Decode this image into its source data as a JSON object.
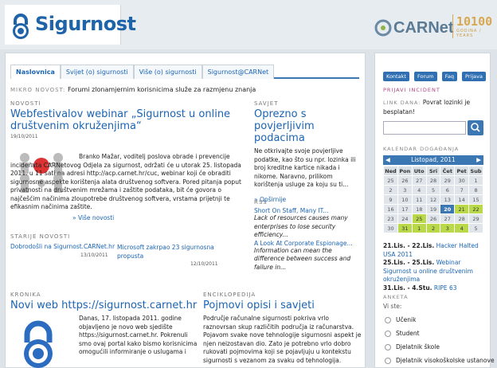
{
  "site": {
    "logo_text": "Sigurnost",
    "carnet_text": "CARNet",
    "tenk_num": "10100",
    "tenk_sub": "GODINA / YEARS"
  },
  "tabs": [
    {
      "label": "Naslovnica"
    },
    {
      "label": "Svijet (o) sigurnosti"
    },
    {
      "label": "Više (o) sigurnosti"
    },
    {
      "label": "Sigurnost@CARNet"
    }
  ],
  "mikro": {
    "label": "MIKRO NOVOST:",
    "text": "Forumi zlonamjernim korisnicima služe za razmjenu znanja"
  },
  "novosti": {
    "label": "NOVOSTI",
    "title": "Webfestivalov webinar „Sigurnost u online društvenim okruženjima“",
    "date": "19/10/2011",
    "body": "Branko Mažar, voditelj poslova obrade i prevencije incidenata CARNetovog Odjela za sigurnost, održati će u utorak 25. listopada 2011. u 11 sati na adresi http://acp.carnet.hr/cuc, webinar koji će obraditi sigurnosne aspekte korištenja alata društvenog softvera. Pored pitanja poput privatnosti na društvenim mrežama i zaštite podataka, bit će govora o najčešćim načinima zloupotrebe društvenog softvera, vrstama prijetnji te efikasnim načinima zaštite.",
    "more": "» Više novosti"
  },
  "stariji": {
    "label": "STARIJE NOVOSTI",
    "item1": "Dobrodošli na Sigurnost.CARNet.hr",
    "date1": "13/10/2011",
    "item2": "Microsoft zakrpao 23 sigurnosna propusta",
    "date2": "12/10/2011"
  },
  "kronika": {
    "label": "KRONIKA",
    "title": "Novi web https://sigurnost.carnet.hr",
    "body": "Danas, 17. listopada 2011. godine objavljeno je novo web sjedište https://sigurnost.carnet.hr. Pokrenuli smo ovaj portal kako bismo korisnicima omogućili informiranje o uslugama i"
  },
  "savjet": {
    "label": "SAVJET",
    "title": "Oprezno s povjerljivim podacima",
    "body": "Ne otkrivajte svoje povjerljive podatke, kao što su npr. lozinka ili broj kreditne kartice nikada i nikome. Naravno, prilikom korištenja usluge za koju su ti...",
    "more": "» Opširnije"
  },
  "rss": {
    "label": "RSS",
    "link1": "Short On Staff, Many IT...",
    "text1": "Lack of resources causes many enterprises to lose security efficiency...",
    "link2": "A Look At Corporate Espionage...",
    "text2": "Information can mean the difference between success and failure in..."
  },
  "enc": {
    "label": "ENCIKLOPEDIJA",
    "title": "Pojmovi opisi i savjeti",
    "body": "Područje računalne sigurnosti pokriva vrlo raznovrsan skup različitih područja iz računarstva. Pojavom svake nove tehnologije sigurnosni aspekt je njen neizostavan dio. Zato je potrebno vrlo dobro rukovati pojmovima koji se pojavljuju u kontekstu sigurnosti s vezanom za svaku od tehnologija."
  },
  "sidebar": {
    "buttons": [
      "Kontakt",
      "Forum",
      "Faq",
      "Prijava"
    ],
    "prijavi": "PRIJAVI INCIDENT",
    "linkdana_label": "LINK DANA:",
    "linkdana_text": "Povrat lozinki je besplatan!",
    "search_placeholder": "",
    "cal_label": "KALENDAR DOGAĐANJA",
    "cal_month": "Listopad, 2011",
    "cal_days": [
      "Ned",
      "Pon",
      "Uto",
      "Sri",
      "Čet",
      "Pet",
      "Sub"
    ],
    "cal_rows": [
      [
        "25",
        "26",
        "27",
        "28",
        "29",
        "30",
        "1"
      ],
      [
        "2",
        "3",
        "4",
        "5",
        "6",
        "7",
        "8"
      ],
      [
        "9",
        "10",
        "11",
        "12",
        "13",
        "14",
        "15"
      ],
      [
        "16",
        "17",
        "18",
        "19",
        "20",
        "21",
        "22"
      ],
      [
        "23",
        "24",
        "25",
        "26",
        "27",
        "28",
        "29"
      ],
      [
        "30",
        "31",
        "1",
        "2",
        "3",
        "4",
        "5"
      ]
    ],
    "ev1_date": "21.Lis. - 22.Lis.",
    "ev1_title": "Hacker Halted USA 2011",
    "ev2_date": "25.Lis. - 25.Lis.",
    "ev2_title": "Webinar Sigurnost u online društvenim okruženjima",
    "ev3_date": "31.Lis. - 4.Stu.",
    "ev3_title": "RIPE 63",
    "anketa": "ANKETA",
    "vi_ste": "Vi ste:",
    "options": [
      "Učenik",
      "Student",
      "Djelatnik škole",
      "Djelatnik visokoškolske ustanove"
    ],
    "accent": "#2f6fb2"
  }
}
